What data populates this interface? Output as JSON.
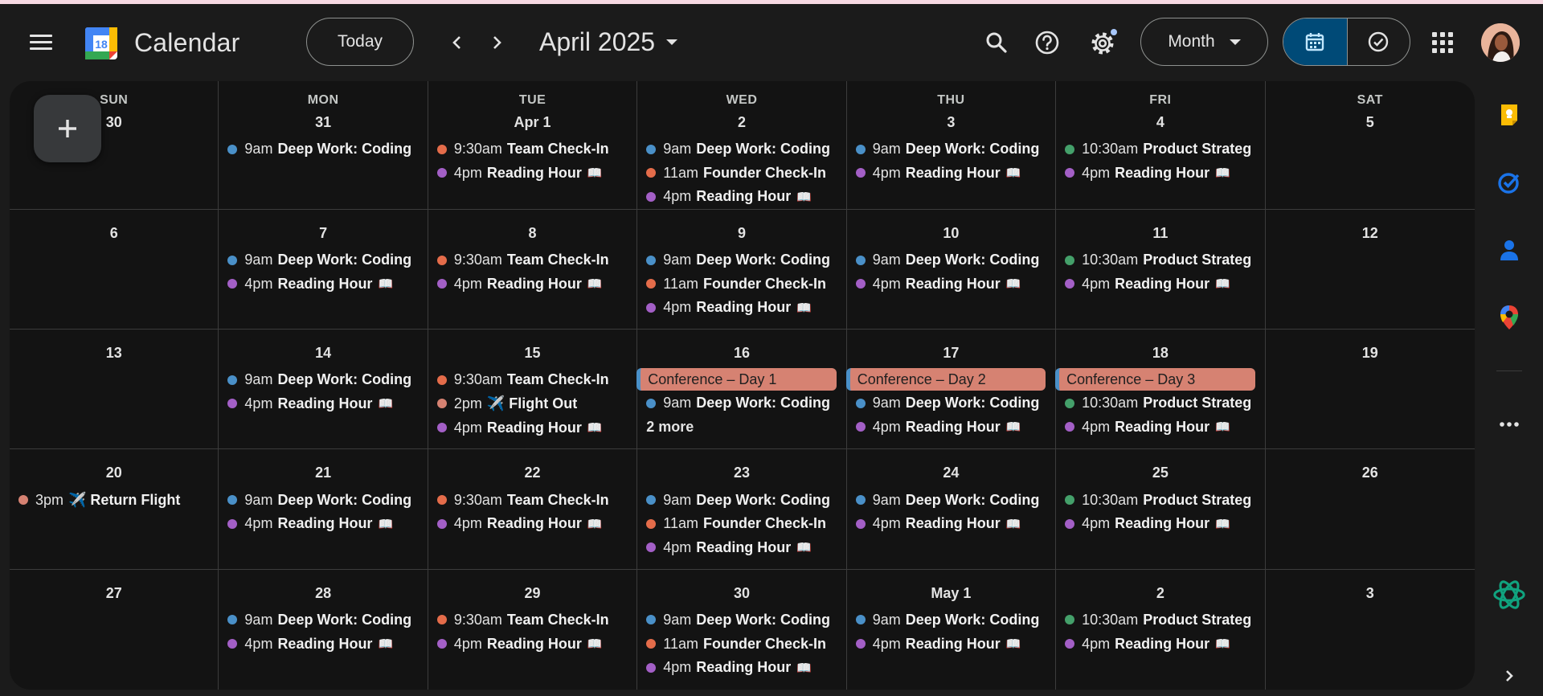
{
  "header": {
    "app_title": "Calendar",
    "logo_day": "18",
    "today_label": "Today",
    "date_title": "April 2025",
    "view_label": "Month"
  },
  "colors": {
    "blue": "#4a90c8",
    "orange": "#e46c4a",
    "purple": "#a35fc6",
    "green": "#44a06a",
    "salmon": "#d68272",
    "conference": "#d68272"
  },
  "icons": [
    "menu-icon",
    "search-icon",
    "help-icon",
    "settings-icon",
    "calendar-view-icon",
    "tasks-view-icon",
    "apps-grid-icon",
    "keep-icon",
    "tasks-icon",
    "contacts-icon",
    "maps-icon",
    "more-icon",
    "gemini-icon",
    "expand-icon",
    "plus-icon"
  ],
  "weekdays": [
    "SUN",
    "MON",
    "TUE",
    "WED",
    "THU",
    "FRI",
    "SAT"
  ],
  "days": [
    {
      "num": "30",
      "events": []
    },
    {
      "num": "31",
      "events": [
        {
          "color": "blue",
          "time": "9am",
          "title": "Deep Work: Coding"
        }
      ]
    },
    {
      "num": "Apr 1",
      "events": [
        {
          "color": "orange",
          "time": "9:30am",
          "title": "Team Check-In"
        },
        {
          "color": "purple",
          "time": "4pm",
          "title": "Reading Hour",
          "emoji": "📖"
        }
      ]
    },
    {
      "num": "2",
      "events": [
        {
          "color": "blue",
          "time": "9am",
          "title": "Deep Work: Coding"
        },
        {
          "color": "orange",
          "time": "11am",
          "title": "Founder Check-In"
        },
        {
          "color": "purple",
          "time": "4pm",
          "title": "Reading Hour",
          "emoji": "📖"
        }
      ]
    },
    {
      "num": "3",
      "events": [
        {
          "color": "blue",
          "time": "9am",
          "title": "Deep Work: Coding"
        },
        {
          "color": "purple",
          "time": "4pm",
          "title": "Reading Hour",
          "emoji": "📖"
        }
      ]
    },
    {
      "num": "4",
      "events": [
        {
          "color": "green",
          "time": "10:30am",
          "title": "Product Strateg"
        },
        {
          "color": "purple",
          "time": "4pm",
          "title": "Reading Hour",
          "emoji": "📖"
        }
      ]
    },
    {
      "num": "5",
      "events": []
    },
    {
      "num": "6",
      "events": []
    },
    {
      "num": "7",
      "events": [
        {
          "color": "blue",
          "time": "9am",
          "title": "Deep Work: Coding"
        },
        {
          "color": "purple",
          "time": "4pm",
          "title": "Reading Hour",
          "emoji": "📖"
        }
      ]
    },
    {
      "num": "8",
      "events": [
        {
          "color": "orange",
          "time": "9:30am",
          "title": "Team Check-In"
        },
        {
          "color": "purple",
          "time": "4pm",
          "title": "Reading Hour",
          "emoji": "📖"
        }
      ]
    },
    {
      "num": "9",
      "events": [
        {
          "color": "blue",
          "time": "9am",
          "title": "Deep Work: Coding"
        },
        {
          "color": "orange",
          "time": "11am",
          "title": "Founder Check-In"
        },
        {
          "color": "purple",
          "time": "4pm",
          "title": "Reading Hour",
          "emoji": "📖"
        }
      ]
    },
    {
      "num": "10",
      "events": [
        {
          "color": "blue",
          "time": "9am",
          "title": "Deep Work: Coding"
        },
        {
          "color": "purple",
          "time": "4pm",
          "title": "Reading Hour",
          "emoji": "📖"
        }
      ]
    },
    {
      "num": "11",
      "events": [
        {
          "color": "green",
          "time": "10:30am",
          "title": "Product Strateg"
        },
        {
          "color": "purple",
          "time": "4pm",
          "title": "Reading Hour",
          "emoji": "📖"
        }
      ]
    },
    {
      "num": "12",
      "events": []
    },
    {
      "num": "13",
      "events": []
    },
    {
      "num": "14",
      "events": [
        {
          "color": "blue",
          "time": "9am",
          "title": "Deep Work: Coding"
        },
        {
          "color": "purple",
          "time": "4pm",
          "title": "Reading Hour",
          "emoji": "📖"
        }
      ]
    },
    {
      "num": "15",
      "events": [
        {
          "color": "orange",
          "time": "9:30am",
          "title": "Team Check-In"
        },
        {
          "color": "salmon",
          "time": "2pm",
          "title": "✈️ Flight Out"
        },
        {
          "color": "purple",
          "time": "4pm",
          "title": "Reading Hour",
          "emoji": "📖"
        }
      ]
    },
    {
      "num": "16",
      "allday": "Conference – Day 1",
      "events": [
        {
          "color": "blue",
          "time": "9am",
          "title": "Deep Work: Coding"
        }
      ],
      "more": "2 more"
    },
    {
      "num": "17",
      "allday": "Conference – Day 2",
      "events": [
        {
          "color": "blue",
          "time": "9am",
          "title": "Deep Work: Coding"
        },
        {
          "color": "purple",
          "time": "4pm",
          "title": "Reading Hour",
          "emoji": "📖"
        }
      ]
    },
    {
      "num": "18",
      "allday": "Conference – Day 3",
      "events": [
        {
          "color": "green",
          "time": "10:30am",
          "title": "Product Strateg"
        },
        {
          "color": "purple",
          "time": "4pm",
          "title": "Reading Hour",
          "emoji": "📖"
        }
      ]
    },
    {
      "num": "19",
      "events": []
    },
    {
      "num": "20",
      "events": [
        {
          "color": "salmon",
          "time": "3pm",
          "title": "✈️ Return Flight"
        }
      ]
    },
    {
      "num": "21",
      "events": [
        {
          "color": "blue",
          "time": "9am",
          "title": "Deep Work: Coding"
        },
        {
          "color": "purple",
          "time": "4pm",
          "title": "Reading Hour",
          "emoji": "📖"
        }
      ]
    },
    {
      "num": "22",
      "events": [
        {
          "color": "orange",
          "time": "9:30am",
          "title": "Team Check-In"
        },
        {
          "color": "purple",
          "time": "4pm",
          "title": "Reading Hour",
          "emoji": "📖"
        }
      ]
    },
    {
      "num": "23",
      "events": [
        {
          "color": "blue",
          "time": "9am",
          "title": "Deep Work: Coding"
        },
        {
          "color": "orange",
          "time": "11am",
          "title": "Founder Check-In"
        },
        {
          "color": "purple",
          "time": "4pm",
          "title": "Reading Hour",
          "emoji": "📖"
        }
      ]
    },
    {
      "num": "24",
      "events": [
        {
          "color": "blue",
          "time": "9am",
          "title": "Deep Work: Coding"
        },
        {
          "color": "purple",
          "time": "4pm",
          "title": "Reading Hour",
          "emoji": "📖"
        }
      ]
    },
    {
      "num": "25",
      "events": [
        {
          "color": "green",
          "time": "10:30am",
          "title": "Product Strateg"
        },
        {
          "color": "purple",
          "time": "4pm",
          "title": "Reading Hour",
          "emoji": "📖"
        }
      ]
    },
    {
      "num": "26",
      "events": []
    },
    {
      "num": "27",
      "events": []
    },
    {
      "num": "28",
      "events": [
        {
          "color": "blue",
          "time": "9am",
          "title": "Deep Work: Coding"
        },
        {
          "color": "purple",
          "time": "4pm",
          "title": "Reading Hour",
          "emoji": "📖"
        }
      ]
    },
    {
      "num": "29",
      "events": [
        {
          "color": "orange",
          "time": "9:30am",
          "title": "Team Check-In"
        },
        {
          "color": "purple",
          "time": "4pm",
          "title": "Reading Hour",
          "emoji": "📖"
        }
      ]
    },
    {
      "num": "30",
      "events": [
        {
          "color": "blue",
          "time": "9am",
          "title": "Deep Work: Coding"
        },
        {
          "color": "orange",
          "time": "11am",
          "title": "Founder Check-In"
        },
        {
          "color": "purple",
          "time": "4pm",
          "title": "Reading Hour",
          "emoji": "📖"
        }
      ]
    },
    {
      "num": "May 1",
      "events": [
        {
          "color": "blue",
          "time": "9am",
          "title": "Deep Work: Coding"
        },
        {
          "color": "purple",
          "time": "4pm",
          "title": "Reading Hour",
          "emoji": "📖"
        }
      ]
    },
    {
      "num": "2",
      "events": [
        {
          "color": "green",
          "time": "10:30am",
          "title": "Product Strateg"
        },
        {
          "color": "purple",
          "time": "4pm",
          "title": "Reading Hour",
          "emoji": "📖"
        }
      ]
    },
    {
      "num": "3",
      "events": []
    }
  ]
}
